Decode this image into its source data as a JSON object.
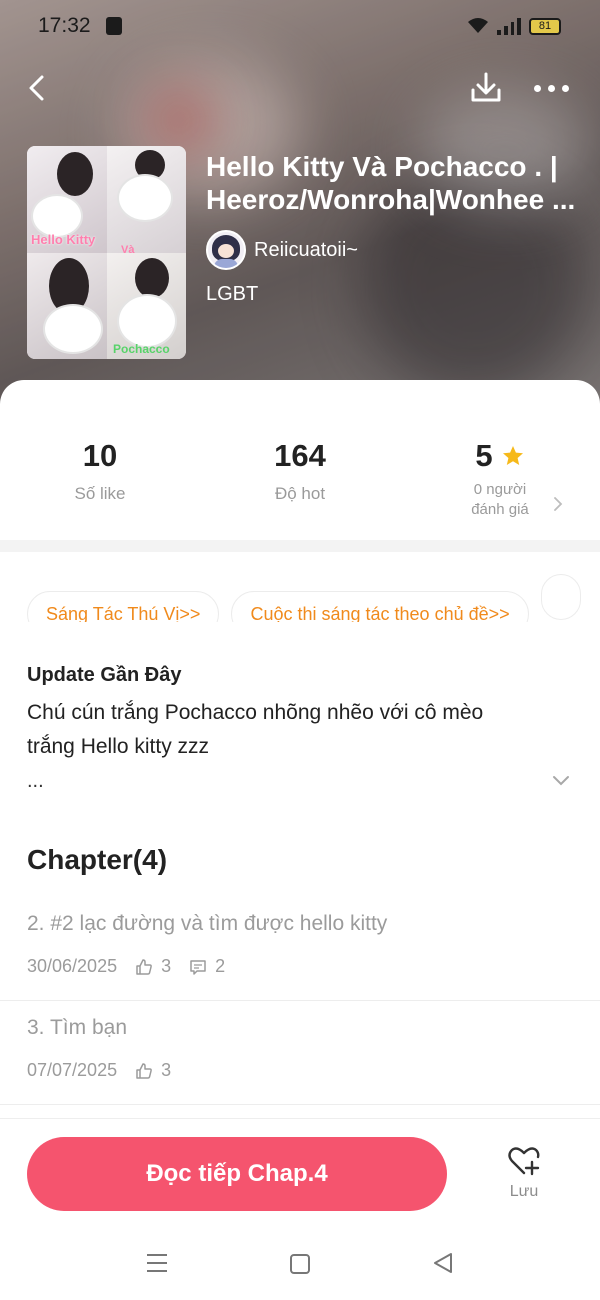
{
  "status_bar": {
    "time": "17:32",
    "battery": "81"
  },
  "story": {
    "title_line1": "Hello Kitty Và Pochacco . |",
    "title_line2": "Heeroz/Wonroha|Wonhee ...",
    "author": "Reiicuatoii~",
    "genre": "LGBT",
    "cover_text": {
      "hello_kitty": "Hello Kitty",
      "va": "Và",
      "pochacco": "Pochacco"
    }
  },
  "stats": {
    "likes": {
      "value": "10",
      "label": "Số like"
    },
    "hot": {
      "value": "164",
      "label": "Độ hot"
    },
    "rating": {
      "value": "5",
      "label_line1": "0 người",
      "label_line2": "đánh giá"
    }
  },
  "tags": [
    "Sáng Tác Thú Vị>>",
    "Cuộc thi sáng tác theo chủ đề>>"
  ],
  "update": {
    "heading": "Update Gần Đây",
    "line1": "Chú cún trắng Pochacco nhõng nhẽo với cô mèo",
    "line2": "trắng Hello kitty zzz",
    "ellipsis": "..."
  },
  "chapters": {
    "heading": "Chapter(4)",
    "items": [
      {
        "title": "2. #2 lạc đường và tìm được hello kitty",
        "date": "30/06/2025",
        "likes": "3",
        "comments": "2"
      },
      {
        "title": "3. Tìm bạn",
        "date": "07/07/2025",
        "likes": "3"
      }
    ]
  },
  "bottom": {
    "read_button": "Đọc tiếp Chap.4",
    "save_label": "Lưu"
  },
  "colors": {
    "accent": "#f5546e",
    "tag": "#f08a1c",
    "star": "#f6b91a"
  },
  "icons": [
    "back-arrow-icon",
    "download-icon",
    "more-icon",
    "star-icon",
    "chevron-right-icon",
    "chevron-down-icon",
    "thumbs-up-icon",
    "comment-icon",
    "heart-plus-icon"
  ]
}
